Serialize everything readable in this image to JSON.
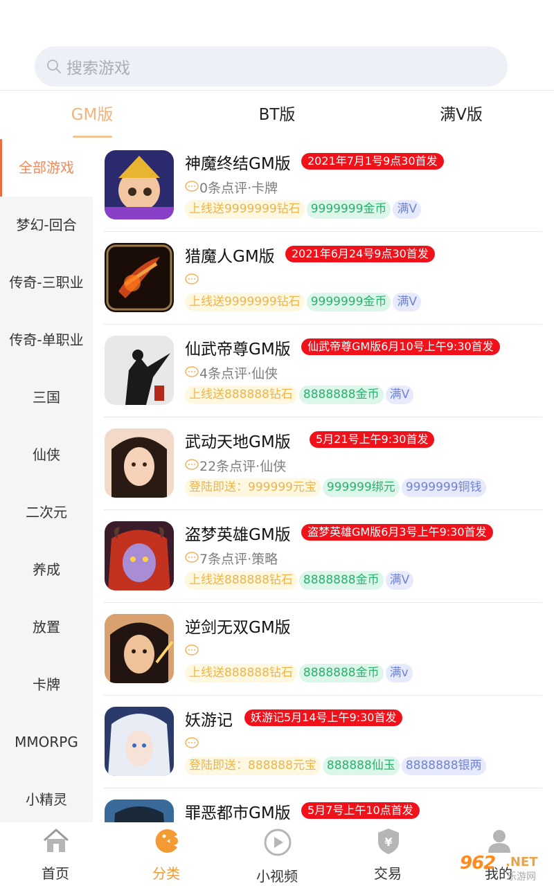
{
  "search": {
    "placeholder": "搜索游戏"
  },
  "top_tabs": [
    {
      "label": "GM版",
      "active": true
    },
    {
      "label": "BT版",
      "active": false
    },
    {
      "label": "满V版",
      "active": false
    }
  ],
  "sidebar": {
    "items": [
      {
        "label": "全部游戏",
        "active": true
      },
      {
        "label": "梦幻-回合"
      },
      {
        "label": "传奇-三职业"
      },
      {
        "label": "传奇-单职业"
      },
      {
        "label": "三国"
      },
      {
        "label": "仙侠"
      },
      {
        "label": "二次元"
      },
      {
        "label": "养成"
      },
      {
        "label": "放置"
      },
      {
        "label": "卡牌"
      },
      {
        "label": "MMORPG"
      },
      {
        "label": "小精灵"
      }
    ]
  },
  "games": [
    {
      "title": "神魔终结GM版",
      "badge": "2021年7月1号9点30首发",
      "meta": "0条点评·卡牌",
      "tags": [
        {
          "text": "上线送9999999钻石",
          "style": "y"
        },
        {
          "text": "9999999金币",
          "style": "g"
        },
        {
          "text": "满V",
          "style": "b"
        }
      ]
    },
    {
      "title": "猎魔人GM版",
      "badge": "2021年6月24号9点30首发",
      "meta": "",
      "tags": [
        {
          "text": "上线送9999999钻石",
          "style": "y"
        },
        {
          "text": "9999999金币",
          "style": "g"
        },
        {
          "text": "满V",
          "style": "b"
        }
      ]
    },
    {
      "title": "仙武帝尊GM版",
      "badge": "仙武帝尊GM版6月10号上午9:30首发",
      "meta": "4条点评·仙侠",
      "tags": [
        {
          "text": "上线送888888钻石",
          "style": "y"
        },
        {
          "text": "8888888金币",
          "style": "g"
        },
        {
          "text": "满V",
          "style": "b"
        }
      ]
    },
    {
      "title": "武动天地GM版",
      "badge": "5月21号上午9:30首发",
      "meta": "22条点评·仙侠",
      "tags": [
        {
          "text": "登陆即送：999999元宝",
          "style": "y"
        },
        {
          "text": "999999绑元",
          "style": "g"
        },
        {
          "text": "9999999铜钱",
          "style": "b"
        }
      ]
    },
    {
      "title": "盗梦英雄GM版",
      "badge": "盗梦英雄GM版6月3号上午9:30首发",
      "meta": "7条点评·策略",
      "tags": [
        {
          "text": "上线送888888钻石",
          "style": "y"
        },
        {
          "text": "8888888金币",
          "style": "g"
        },
        {
          "text": "满V",
          "style": "b"
        }
      ]
    },
    {
      "title": "逆剑无双GM版",
      "badge": "",
      "meta": "",
      "tags": [
        {
          "text": "上线送888888钻石",
          "style": "y"
        },
        {
          "text": "8888888金币",
          "style": "g"
        },
        {
          "text": "满v",
          "style": "b"
        }
      ]
    },
    {
      "title": "妖游记",
      "badge": "妖游记5月14号上午9:30首发",
      "meta": "",
      "tags": [
        {
          "text": "登陆即送：888888元宝",
          "style": "y"
        },
        {
          "text": "888888仙玉",
          "style": "g"
        },
        {
          "text": "8888888银两",
          "style": "b"
        }
      ]
    },
    {
      "title": "罪恶都市GM版",
      "badge": "5月7号上午10点首发",
      "meta": "",
      "tags": []
    }
  ],
  "bottom_nav": [
    {
      "label": "首页",
      "icon": "home-icon"
    },
    {
      "label": "分类",
      "icon": "category-icon",
      "active": true
    },
    {
      "label": "小视频",
      "icon": "video-icon"
    },
    {
      "label": "交易",
      "icon": "trade-icon"
    },
    {
      "label": "我的",
      "icon": "profile-icon"
    }
  ],
  "watermark": {
    "brand": "962",
    "net": ".NET",
    "sub": "乐游网"
  },
  "colors": {
    "accent": "#f39a32",
    "badge_red": "#f0121b",
    "sidebar_active": "#ee8a5a"
  }
}
